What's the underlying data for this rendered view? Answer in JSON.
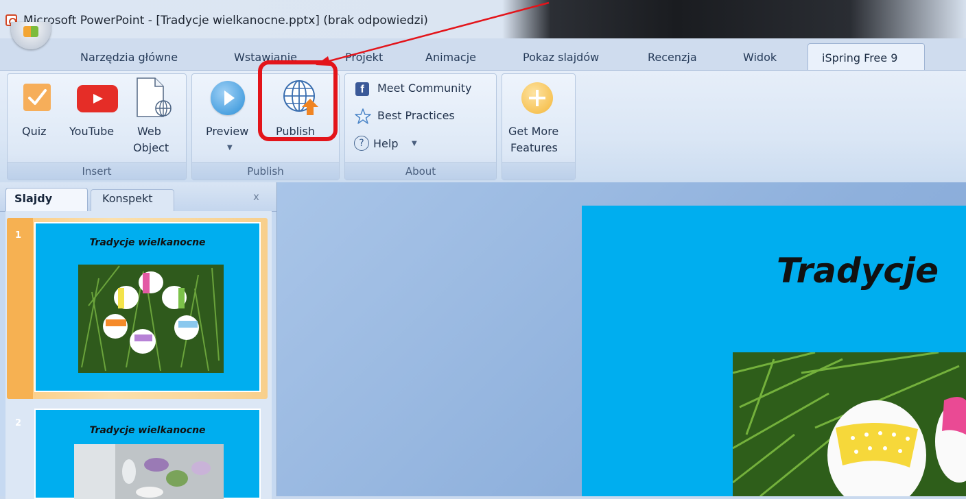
{
  "window": {
    "title": "Microsoft PowerPoint - [Tradycje wielkanocne.pptx] (brak odpowiedzi)"
  },
  "tabs": [
    "Narzędzia główne",
    "Wstawianie",
    "Projekt",
    "Animacje",
    "Pokaz slajdów",
    "Recenzja",
    "Widok",
    "iSpring Free 9"
  ],
  "ribbon": {
    "insert": {
      "label": "Insert",
      "quiz": "Quiz",
      "youtube": "YouTube",
      "web_object_1": "Web",
      "web_object_2": "Object"
    },
    "publish": {
      "label": "Publish",
      "preview": "Preview",
      "publish": "Publish"
    },
    "about": {
      "label": "About",
      "meet_community": "Meet Community",
      "best_practices": "Best Practices",
      "help": "Help"
    },
    "more": {
      "get_more_1": "Get More",
      "get_more_2": "Features"
    }
  },
  "panel": {
    "tab_slides": "Slajdy",
    "tab_outline": "Konspekt",
    "close": "x"
  },
  "slides": [
    {
      "number": "1",
      "title": "Tradycje wielkanocne"
    },
    {
      "number": "2",
      "title": "Tradycje wielkanocne"
    }
  ],
  "main_slide": {
    "title": "Tradycje"
  },
  "colors": {
    "slide_bg": "#00aeef",
    "highlight": "#e3141a"
  }
}
